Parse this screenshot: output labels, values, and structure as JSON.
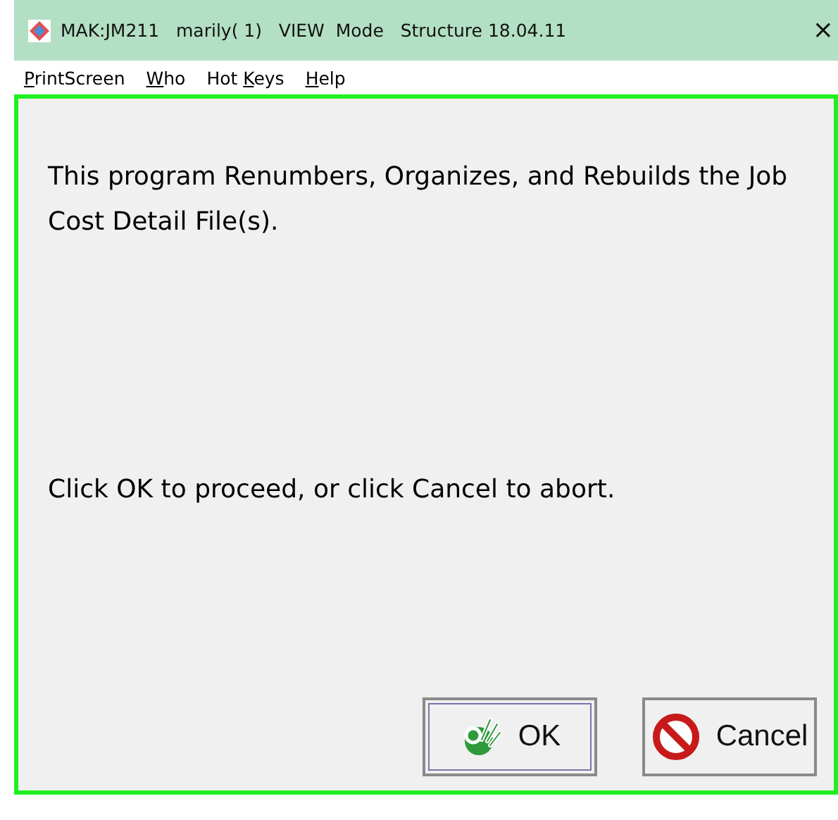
{
  "window": {
    "title": "MAK:JM211   marily( 1)   VIEW  Mode   Structure 18.04.11",
    "close": "×"
  },
  "menu": [
    {
      "key": "P",
      "after": "rintScreen"
    },
    {
      "key": "W",
      "after": "ho"
    },
    {
      "before": "Hot ",
      "key": "K",
      "after": "eys"
    },
    {
      "key": "H",
      "after": "elp"
    }
  ],
  "message": "This program Renumbers, Organizes, and Rebuilds the Job Cost Detail File(s).",
  "prompt": "Click OK to proceed, or click Cancel to abort.",
  "buttons": [
    {
      "kind": "ok",
      "label": "OK",
      "selected": true
    },
    {
      "kind": "cancel",
      "label": "Cancel",
      "selected": false
    }
  ]
}
